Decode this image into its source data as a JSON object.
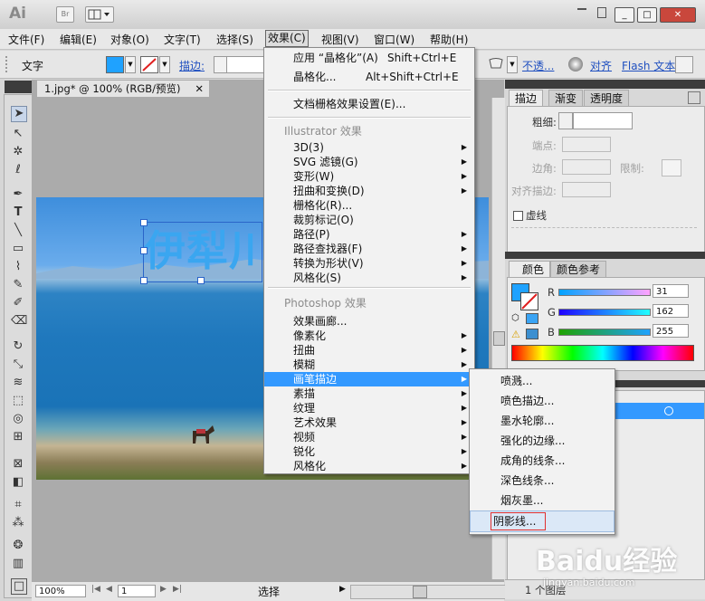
{
  "titlebar": {
    "logo": "Ai",
    "br_label": "Br"
  },
  "menubar": {
    "items": [
      {
        "label": "文件(F)"
      },
      {
        "label": "编辑(E)"
      },
      {
        "label": "对象(O)"
      },
      {
        "label": "文字(T)"
      },
      {
        "label": "选择(S)"
      },
      {
        "label": "效果(C)"
      },
      {
        "label": "视图(V)"
      },
      {
        "label": "窗口(W)"
      },
      {
        "label": "帮助(H)"
      }
    ]
  },
  "controlbar": {
    "mode_label": "文字",
    "stroke_label": "描边:",
    "opacity_label": "不透...",
    "align_label": "对齐",
    "flash_label": "Flash 文本"
  },
  "document": {
    "tab_title": "1.jpg* @ 100% (RGB/预览)",
    "text_object": "伊犁川"
  },
  "statusbar": {
    "zoom": "100%",
    "page": "1",
    "mode": "选择"
  },
  "effects_menu": {
    "recent": [
      {
        "label": "应用 “晶格化”(A)",
        "shortcut": "Shift+Ctrl+E"
      },
      {
        "label": "晶格化...",
        "shortcut": "Alt+Shift+Ctrl+E"
      }
    ],
    "doc_raster": "文档栅格效果设置(E)...",
    "illustrator_header": "Illustrator 效果",
    "illustrator_items": [
      {
        "label": "3D(3)",
        "sub": true
      },
      {
        "label": "SVG 滤镜(G)",
        "sub": true
      },
      {
        "label": "变形(W)",
        "sub": true
      },
      {
        "label": "扭曲和变换(D)",
        "sub": true
      },
      {
        "label": "栅格化(R)...",
        "sub": false
      },
      {
        "label": "裁剪标记(O)",
        "sub": false
      },
      {
        "label": "路径(P)",
        "sub": true
      },
      {
        "label": "路径查找器(F)",
        "sub": true
      },
      {
        "label": "转换为形状(V)",
        "sub": true
      },
      {
        "label": "风格化(S)",
        "sub": true
      }
    ],
    "photoshop_header": "Photoshop 效果",
    "photoshop_items": [
      {
        "label": "效果画廊...",
        "sub": false
      },
      {
        "label": "像素化",
        "sub": true
      },
      {
        "label": "扭曲",
        "sub": true
      },
      {
        "label": "模糊",
        "sub": true
      },
      {
        "label": "画笔描边",
        "sub": true
      },
      {
        "label": "素描",
        "sub": true
      },
      {
        "label": "纹理",
        "sub": true
      },
      {
        "label": "艺术效果",
        "sub": true
      },
      {
        "label": "视频",
        "sub": true
      },
      {
        "label": "锐化",
        "sub": true
      },
      {
        "label": "风格化",
        "sub": true
      }
    ]
  },
  "brush_submenu": {
    "items": [
      "喷溅...",
      "喷色描边...",
      "墨水轮廓...",
      "强化的边缘...",
      "成角的线条...",
      "深色线条...",
      "烟灰墨...",
      "阴影线..."
    ]
  },
  "stroke_panel": {
    "tabs": [
      "描边",
      "渐变",
      "透明度"
    ],
    "weight_label": "粗细:",
    "cap_label": "端点:",
    "corner_label": "边角:",
    "limit_label": "限制:",
    "align_label": "对齐描边:",
    "dashed_label": "虚线"
  },
  "color_panel": {
    "tabs": [
      "颜色",
      "颜色参考"
    ],
    "r_label": "R",
    "g_label": "G",
    "b_label": "B",
    "r": 31,
    "g": 162,
    "b": 255,
    "swatch": "#1fa2ff"
  },
  "layers": {
    "count_label": "1 个图层"
  },
  "watermark": {
    "brand": "Baidu经验",
    "url": "jingyan.baidu.com"
  }
}
